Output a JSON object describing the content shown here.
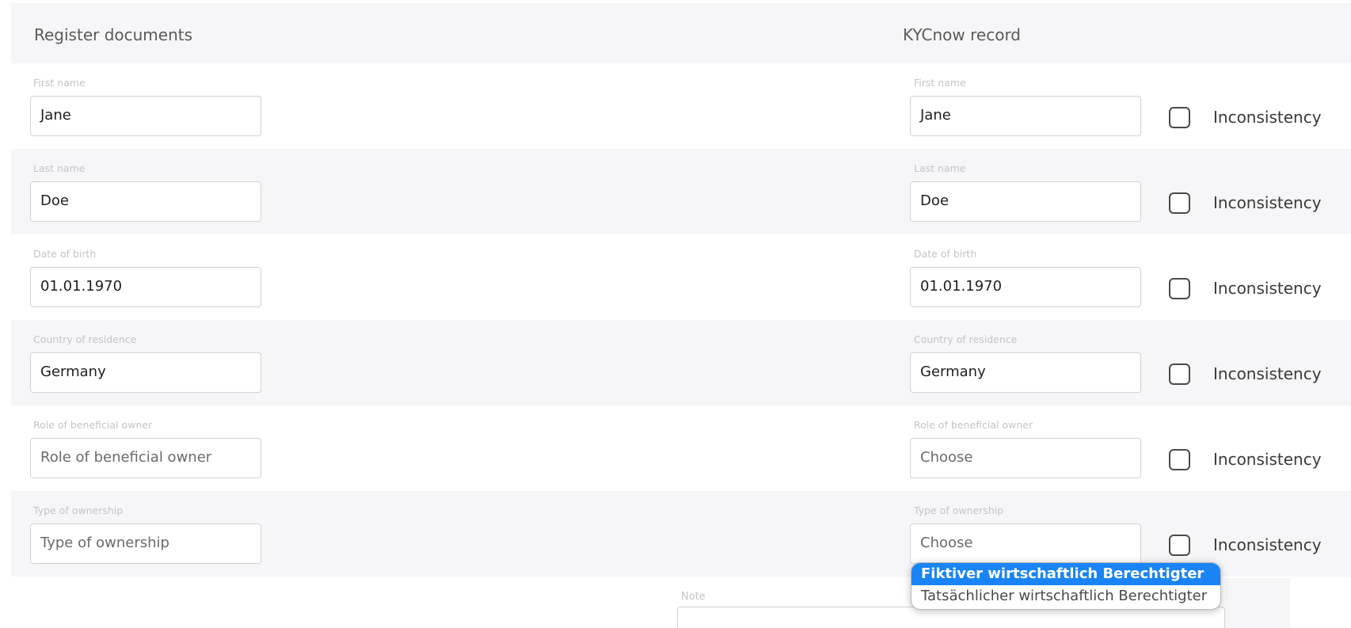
{
  "header": {
    "left_title": "Register documents",
    "right_title": "KYCnow record"
  },
  "rows": [
    {
      "label": "First name",
      "left_value": "Jane",
      "right_value": "Jane",
      "checkbox_label": "Inconsistency"
    },
    {
      "label": "Last name",
      "left_value": "Doe",
      "right_value": "Doe",
      "checkbox_label": "Inconsistency"
    },
    {
      "label": "Date of birth",
      "left_value": "01.01.1970",
      "right_value": "01.01.1970",
      "checkbox_label": "Inconsistency"
    },
    {
      "label": "Country of residence",
      "left_value": "Germany",
      "right_value": "Germany",
      "checkbox_label": "Inconsistency"
    },
    {
      "label": "Role of beneficial owner",
      "left_placeholder": "Role of beneficial owner",
      "right_placeholder": "Choose",
      "checkbox_label": "Inconsistency"
    },
    {
      "label": "Type of ownership",
      "left_placeholder": "Type of ownership",
      "right_placeholder": "Choose",
      "checkbox_label": "Inconsistency"
    }
  ],
  "note": {
    "label": "Note"
  },
  "dropdown": {
    "options": [
      "Fiktiver wirtschaftlich Berechtigter",
      "Tatsächlicher wirtschaftlich Berechtigter"
    ],
    "highlighted_index": 0
  },
  "colors": {
    "row_alt_bg": "#f6f6f8",
    "highlight": "#1a84f6"
  }
}
